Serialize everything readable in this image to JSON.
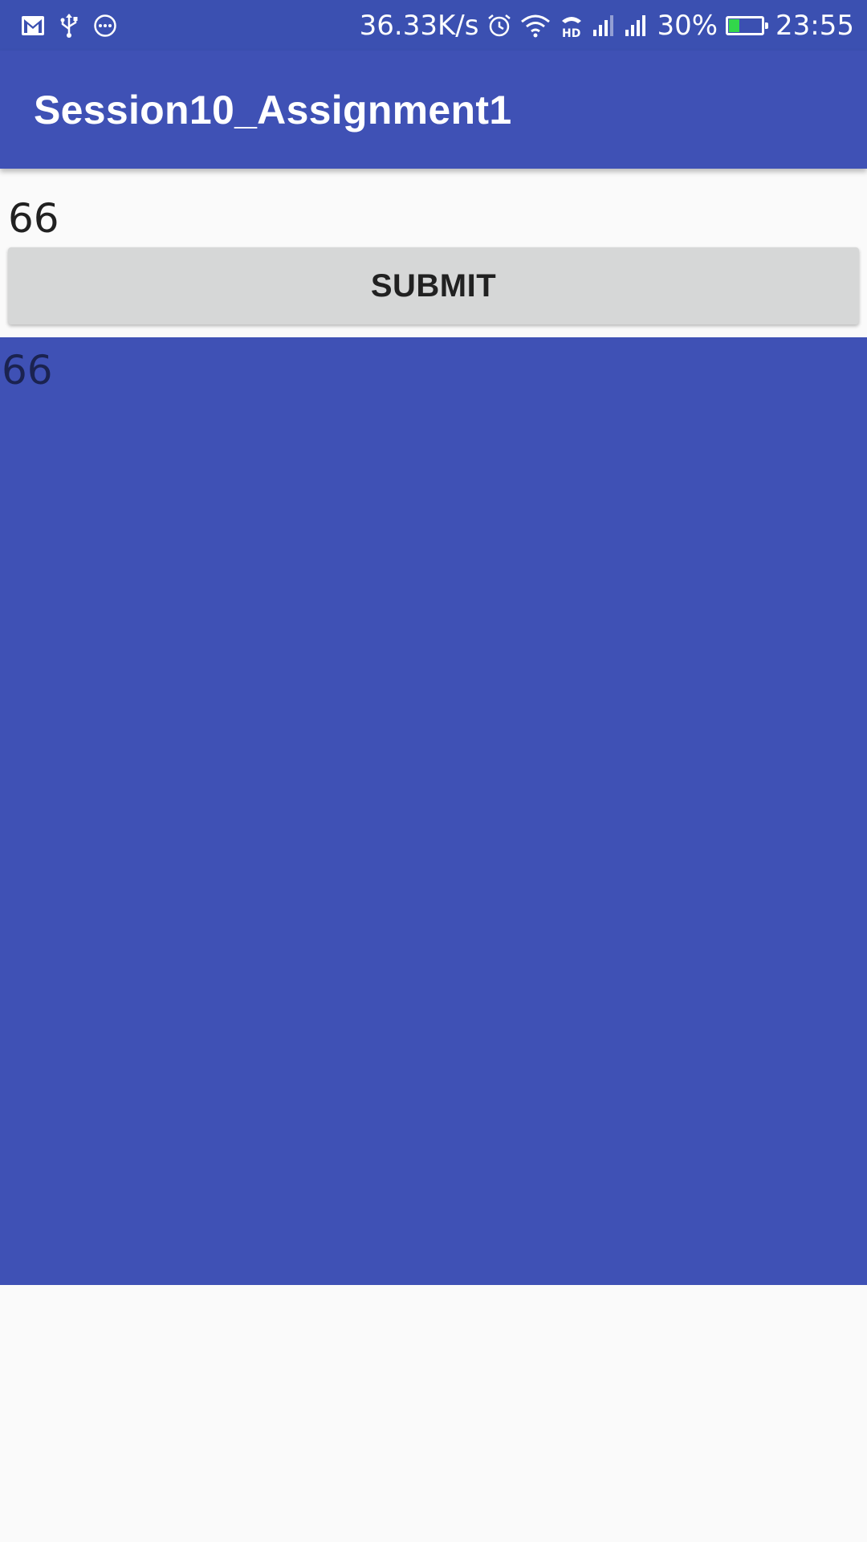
{
  "status_bar": {
    "icons_left": [
      "gmail-icon",
      "usb-icon",
      "more-icon"
    ],
    "network_speed": "36.33K/s",
    "icons_right": [
      "alarm-icon",
      "wifi-icon",
      "hd-call-icon",
      "signal-icon",
      "signal-icon"
    ],
    "battery_percent_text": "30%",
    "battery_level": 0.3,
    "battery_color": "#32d74b",
    "time": "23:55"
  },
  "app_bar": {
    "title": "Session10_Assignment1",
    "color": "#3f51b5"
  },
  "form": {
    "input_value": "66",
    "submit_label": "SUBMIT"
  },
  "result_panel": {
    "text": "66",
    "color": "#3f51b5"
  }
}
